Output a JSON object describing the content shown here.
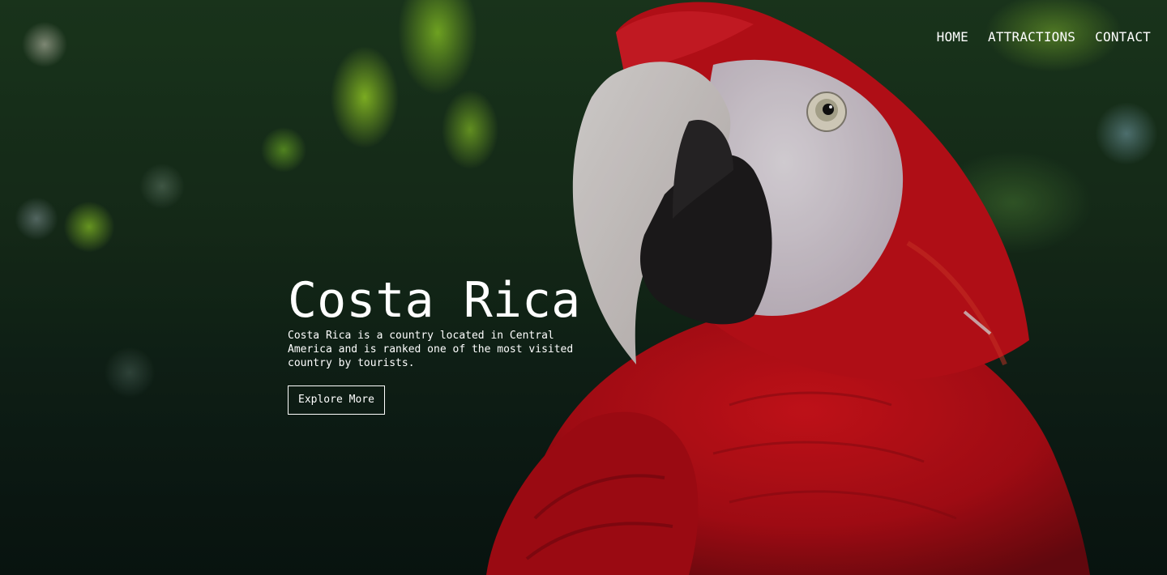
{
  "nav": {
    "items": [
      {
        "label": "HOME"
      },
      {
        "label": "ATTRACTIONS"
      },
      {
        "label": "CONTACT"
      }
    ]
  },
  "hero": {
    "title": "Costa Rica",
    "description": "Costa Rica is a country located in Central America and is ranked one of the most visited country by tourists.",
    "button_label": "Explore More",
    "background_image": "scarlet-macaw-photo",
    "text_color": "#ffffff"
  }
}
